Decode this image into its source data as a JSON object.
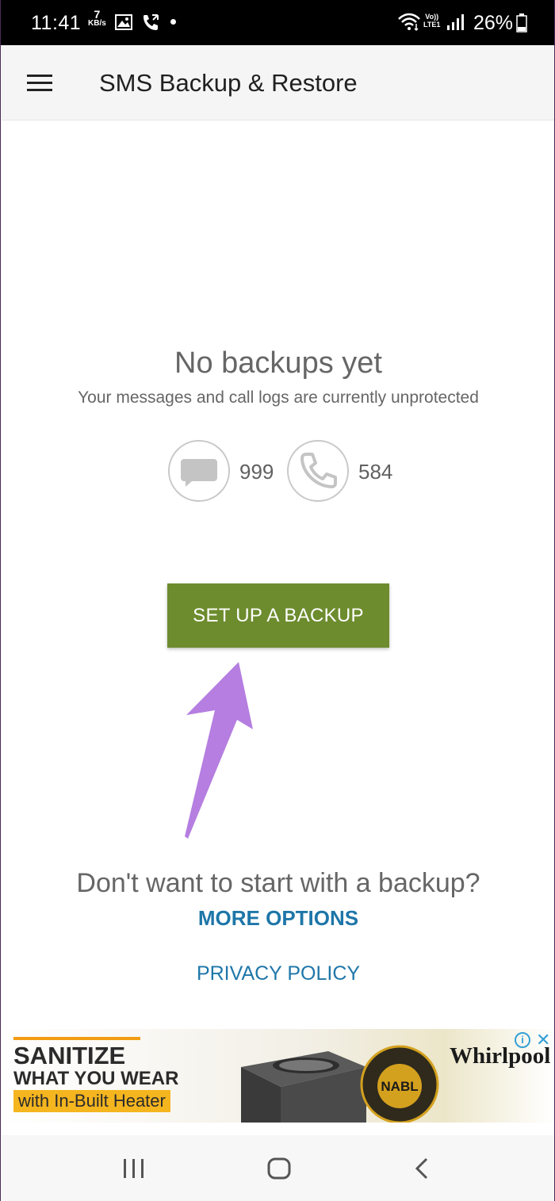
{
  "status_bar": {
    "time": "11:41",
    "net_speed_value": "7",
    "net_speed_unit": "KB/s",
    "volte_top": "Vo))",
    "volte_bottom": "LTE1",
    "battery": "26%",
    "icons": [
      "gallery-icon",
      "call-icon",
      "wifi-icon",
      "signal-icon",
      "battery-icon"
    ]
  },
  "app_bar": {
    "title": "SMS Backup & Restore",
    "menu_icon": "hamburger-menu-icon"
  },
  "empty_state": {
    "title": "No backups yet",
    "subtitle": "Your messages and call logs are currently unprotected",
    "messages_count": "999",
    "calls_count": "584"
  },
  "actions": {
    "setup_label": "SET UP A BACKUP",
    "dont_want": "Don't want to start with a backup?",
    "more_options": "MORE OPTIONS",
    "privacy_policy": "PRIVACY POLICY"
  },
  "ad": {
    "line1": "SANITIZE",
    "line2": "WHAT YOU WEAR",
    "line3": "with In-Built Heater",
    "brand": "Whirlpool",
    "badge": "NABL"
  },
  "colors": {
    "primary_button": "#6d8c2e",
    "link": "#1e76a8",
    "annotation_arrow": "#b57ee0"
  }
}
